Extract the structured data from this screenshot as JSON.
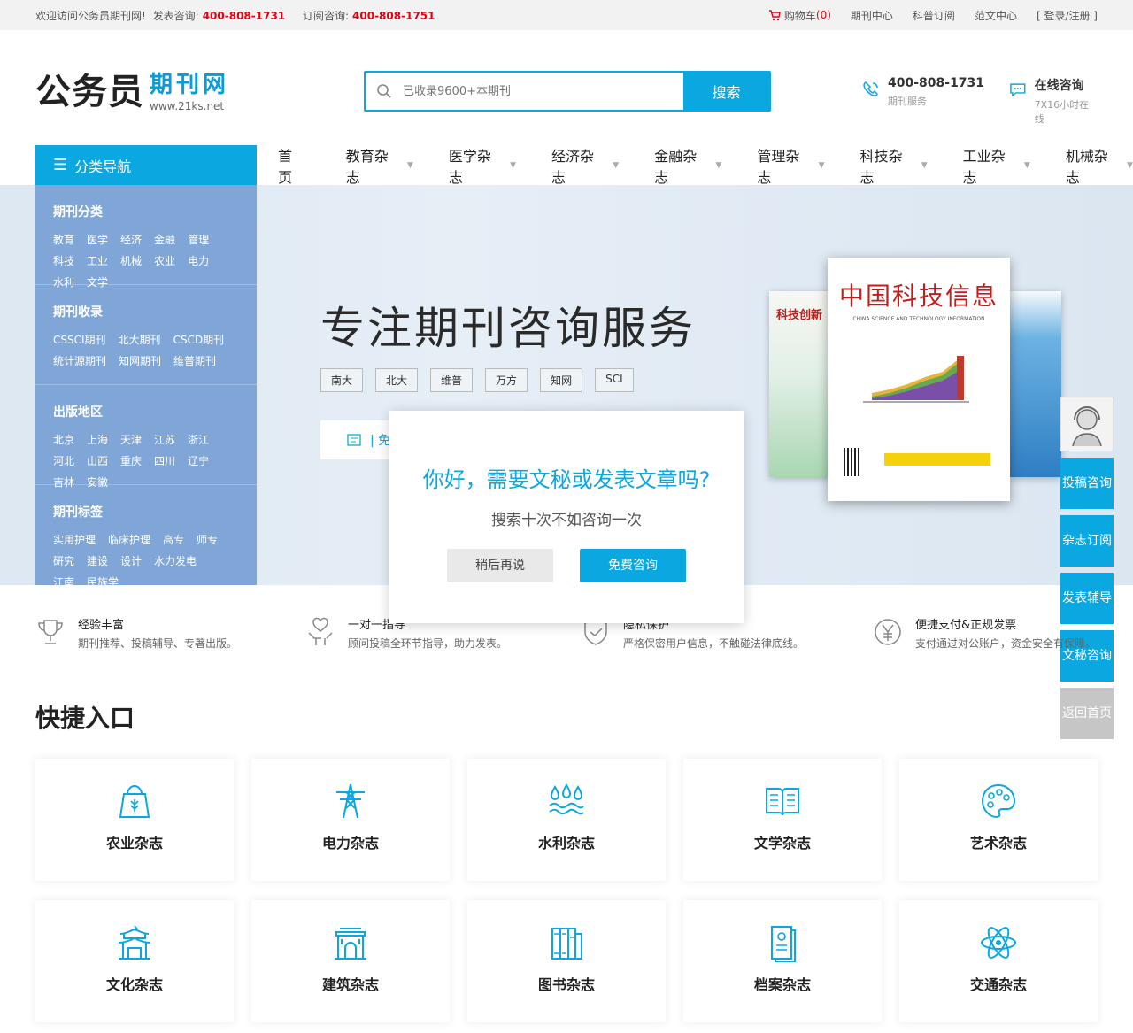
{
  "topbar": {
    "welcome": "欢迎访问公务员期刊网!",
    "publish_label": "发表咨询:",
    "publish_phone": "400-808-1731",
    "subscribe_label": "订阅咨询:",
    "subscribe_phone": "400-808-1751",
    "cart_label": "购物车",
    "cart_count": "(0)",
    "links": [
      "期刊中心",
      "科普订阅",
      "范文中心",
      "[ 登录/注册 ]"
    ]
  },
  "header": {
    "logo_main": "公务员",
    "logo_sub": "期刊网",
    "logo_url": "www.21ks.net",
    "search_placeholder": "已收录9600+本期刊",
    "search_button": "搜索",
    "phone": "400-808-1731",
    "phone_sub": "期刊服务",
    "online": "在线咨询",
    "online_sub": "7X16小时在线"
  },
  "nav": {
    "category_button": "分类导航",
    "items": [
      {
        "label": "首 页",
        "dropdown": false
      },
      {
        "label": "教育杂志",
        "dropdown": true
      },
      {
        "label": "医学杂志",
        "dropdown": true
      },
      {
        "label": "经济杂志",
        "dropdown": true
      },
      {
        "label": "金融杂志",
        "dropdown": true
      },
      {
        "label": "管理杂志",
        "dropdown": true
      },
      {
        "label": "科技杂志",
        "dropdown": true
      },
      {
        "label": "工业杂志",
        "dropdown": true
      },
      {
        "label": "机械杂志",
        "dropdown": true
      }
    ]
  },
  "sidebar": [
    {
      "title": "期刊分类",
      "items": [
        "教育",
        "医学",
        "经济",
        "金融",
        "管理",
        "科技",
        "工业",
        "机械",
        "农业",
        "电力",
        "水利",
        "文学"
      ]
    },
    {
      "title": "期刊收录",
      "items": [
        "CSSCI期刊",
        "北大期刊",
        "CSCD期刊",
        "统计源期刊",
        "知网期刊",
        "维普期刊"
      ]
    },
    {
      "title": "出版地区",
      "items": [
        "北京",
        "上海",
        "天津",
        "江苏",
        "浙江",
        "河北",
        "山西",
        "重庆",
        "四川",
        "辽宁",
        "吉林",
        "安徽"
      ]
    },
    {
      "title": "期刊标签",
      "items": [
        "实用护理",
        "临床护理",
        "高专",
        "师专",
        "研究",
        "建设",
        "设计",
        "水力发电",
        "江南",
        "民族学"
      ]
    }
  ],
  "banner": {
    "slogan": "专注期刊咨询服务",
    "tags": [
      "南大",
      "北大",
      "维普",
      "万方",
      "知网",
      "SCI"
    ],
    "search_partial": "|  免",
    "magazine_main_title": "中国科技信息",
    "magazine_main_en": "CHINA SCIENCE AND TECHNOLOGY INFORMATION",
    "magazine_left_title": "科技创新"
  },
  "float": {
    "buttons": [
      "投稿咨询",
      "杂志订阅",
      "发表辅导",
      "文秘咨询",
      "返回首页"
    ]
  },
  "modal": {
    "question": "你好，需要文秘或发表文章吗?",
    "subtitle": "搜索十次不如咨询一次",
    "later_button": "稍后再说",
    "free_button": "免费咨询"
  },
  "features": [
    {
      "title": "经验丰富",
      "desc": "期刊推荐、投稿辅导、专著出版。",
      "icon": "trophy-icon"
    },
    {
      "title": "一对一指导",
      "desc": "顾问投稿全环节指导，助力发表。",
      "icon": "heart-hand-icon"
    },
    {
      "title": "隐私保护",
      "desc": "严格保密用户信息，不触碰法律底线。",
      "icon": "shield-icon"
    },
    {
      "title": "便捷支付&正规发票",
      "desc": "支付通过对公账户，资金安全有保障。",
      "icon": "yen-icon"
    }
  ],
  "quick": {
    "title": "快捷入口",
    "items": [
      {
        "label": "农业杂志",
        "icon": "agriculture-icon"
      },
      {
        "label": "电力杂志",
        "icon": "power-tower-icon"
      },
      {
        "label": "水利杂志",
        "icon": "water-icon"
      },
      {
        "label": "文学杂志",
        "icon": "book-icon"
      },
      {
        "label": "艺术杂志",
        "icon": "palette-icon"
      },
      {
        "label": "文化杂志",
        "icon": "pavilion-icon"
      },
      {
        "label": "建筑杂志",
        "icon": "building-icon"
      },
      {
        "label": "图书杂志",
        "icon": "books-icon"
      },
      {
        "label": "档案杂志",
        "icon": "archive-icon"
      },
      {
        "label": "交通杂志",
        "icon": "atom-icon"
      }
    ]
  },
  "colors": {
    "accent": "#0aa7e0",
    "red": "#e60012",
    "sidebar": "#7fa6d6"
  }
}
